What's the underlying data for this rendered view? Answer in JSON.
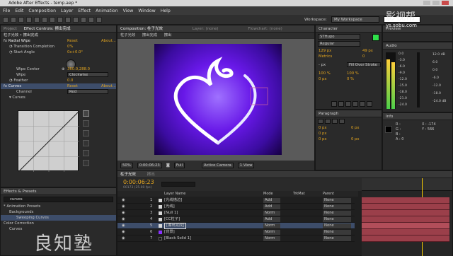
{
  "window": {
    "title": "Adobe After Effects - temp.aep *"
  },
  "menu": {
    "items": [
      "File",
      "Edit",
      "Composition",
      "Layer",
      "Effect",
      "Animation",
      "View",
      "Window",
      "Help"
    ]
  },
  "toolbar": {
    "workspace_label": "Workspace:",
    "workspace_value": "My Workspace",
    "search_placeholder": ""
  },
  "project_panel": {
    "tab_project": "Project",
    "tab_effect_controls": "Effect Controls: 擦出完成",
    "layer_path": "柱子光效 • 擦出完成",
    "effects": [
      {
        "name": "Radial Wipe",
        "action": "Reset",
        "about": "About..."
      },
      {
        "name": "Transition Completion",
        "value": "0%"
      },
      {
        "name": "Start Angle",
        "value": "0x+0.0°"
      },
      {
        "name": "Wipe Center",
        "value": "360.0,288.0"
      },
      {
        "name": "Wipe",
        "value": "Clockwise"
      },
      {
        "name": "Feather",
        "value": "0.0"
      },
      {
        "name": "Curves",
        "action": "Reset",
        "about": "About..."
      },
      {
        "name": "Channel",
        "value": "Red"
      },
      {
        "name": "Curves",
        "value": ""
      }
    ]
  },
  "effects_presets": {
    "title": "Effects & Presets",
    "search_value": "curves",
    "items": [
      "* Animation Presets",
      "Backgrounds",
      "Sweeping Curves",
      "Color Correction",
      "Curves"
    ]
  },
  "composition": {
    "tab_label": "Composition: 柱子光效",
    "layer_tab": "Layer: (none)",
    "flowchart_tab": "Flowchart: (none)",
    "breadcrumb": [
      "柱子光效",
      "擦出完成",
      "擦出"
    ],
    "zoom": "50%",
    "timecode": "0:00:06:23",
    "resolution": "Full",
    "camera": "Active Camera",
    "views": "1 View"
  },
  "character_panel": {
    "title": "Character",
    "font": "STHupo",
    "style": "Regular",
    "size": "129 px",
    "leading": "49 px",
    "kerning": "Metrics",
    "tracking": "0",
    "stroke_width": "- px",
    "stroke_type": "Fill Over Stroke",
    "vert_scale": "100 %",
    "horiz_scale": "100 %",
    "baseline": "0 px",
    "tsume": "0 %"
  },
  "paragraph_panel": {
    "title": "Paragraph",
    "fields": [
      "0 px",
      "0 px",
      "0 px",
      "0 px",
      "0 px"
    ]
  },
  "preview_panel": {
    "title": "Preview"
  },
  "audio_panel": {
    "title": "Audio",
    "left_values": [
      "0.0",
      "-3.0",
      "-6.0",
      "-9.0",
      "-12.0",
      "-15.0",
      "-18.0",
      "-21.0",
      "-24.0"
    ],
    "right_values": [
      "12.0 dB",
      "6.0",
      "0.0",
      "-6.0",
      "-12.0",
      "-18.0",
      "-24.0 dB"
    ]
  },
  "info_panel": {
    "title": "Info",
    "x": "X : -174",
    "y": "Y : 566",
    "r": "R :",
    "g": "G :",
    "b": "B :",
    "a": "A : 0"
  },
  "timeline": {
    "tab_active": "柱子光效",
    "tab_other": "擦出",
    "timecode": "0:00:06:23",
    "frame_info": "00173 (25.00 fps)",
    "col_layer_name": "Layer Name",
    "col_mode": "Mode",
    "col_trkmat": "TrkMat",
    "col_parent": "Parent",
    "layers": [
      {
        "num": "1",
        "name": "[光线描边]",
        "mode": "Add",
        "parent": "None",
        "color": "#d8d8d8"
      },
      {
        "num": "2",
        "name": "[光线]",
        "mode": "Add",
        "parent": "None",
        "color": "#d8d8d8"
      },
      {
        "num": "3",
        "name": "[Null 1]",
        "mode": "Norm",
        "parent": "None",
        "color": "#d8d8d8"
      },
      {
        "num": "4",
        "name": "[CC粒子]",
        "mode": "Add",
        "parent": "None",
        "color": "#d8d8d8"
      },
      {
        "num": "5",
        "name": "[擦出完成]",
        "mode": "Norm",
        "parent": "None",
        "color": "#d8d8d8"
      },
      {
        "num": "6",
        "name": "[背景]",
        "mode": "Norm",
        "parent": "None",
        "color": "#8a32ff"
      },
      {
        "num": "7",
        "name": "[Black Solid 1]",
        "mode": "Norm",
        "parent": "None",
        "color": "#111111"
      }
    ]
  },
  "watermark": {
    "top_right_cn": "影视帮",
    "top_right_url": "ys.sobu.com",
    "bottom_left": "良知塾"
  }
}
